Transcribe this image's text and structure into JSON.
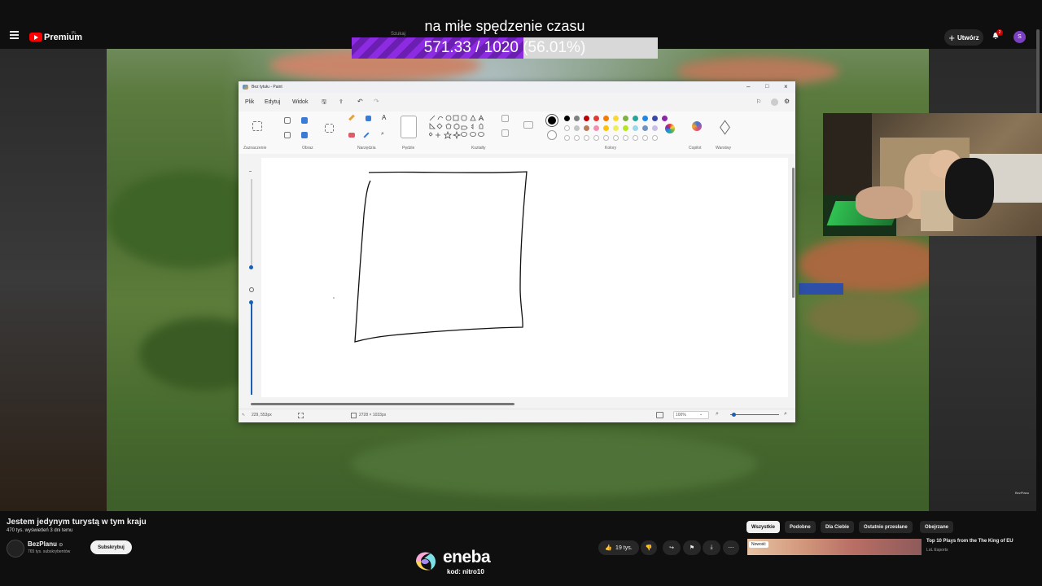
{
  "youtube": {
    "premium_label": "Premium",
    "country_code": "PL",
    "search_placeholder": "Szukaj",
    "create_label": "Utwórz",
    "notification_count": "2",
    "avatar_letter": "S"
  },
  "overlay": {
    "title": "na miłe spędzenie czasu",
    "progress_text": "571.33 / 1020",
    "progress_pct_text": "(56.01%)",
    "progress_fraction": 0.5601
  },
  "paint": {
    "window_title": "Bez tytułu - Paint",
    "menu": [
      "Plik",
      "Edytuj",
      "Widok"
    ],
    "groups": {
      "selection": "Zaznaczenie",
      "image": "Obraz",
      "tools": "Narzędzia",
      "brushes": "Pędzle",
      "shapes": "Kształty",
      "colors": "Kolory",
      "copilot": "Copilot",
      "layers": "Warstwy"
    },
    "palette": [
      "#000000",
      "#7f7f7f",
      "#c00000",
      "#e53935",
      "#f57c00",
      "#fdd835",
      "#7cb342",
      "#26a69a",
      "#1e88e5",
      "#3949ab",
      "#8e24aa"
    ],
    "palette_row2": [
      "#ffffff",
      "#c3c3c3",
      "#b97a57",
      "#f48fb1",
      "#ffc107",
      "#eeee58",
      "#b5e61d",
      "#99d9ea",
      "#7092be",
      "#c8bfe7"
    ],
    "status": {
      "cursor_pos": "229, 553px",
      "canvas_size": "2728 × 1033px",
      "zoom": "100%"
    }
  },
  "video": {
    "watermark": "BezPlanu",
    "title": "Jestem jedynym turystą w tym kraju",
    "meta": "470 tys. wyświetleń  3 dni temu",
    "channel_name": "BezPlanu",
    "channel_subs": "765 tys. subskrybentów",
    "subscribe_label": "Subskrybuj",
    "like_count": "19 tys."
  },
  "chips": [
    "Wszystkie",
    "Podobne",
    "Dla Ciebie",
    "Ostatnio przesłane",
    "Obejrzane"
  ],
  "recommendation": {
    "badge": "Nowość",
    "title": "Top 10 Plays from the The King of EU",
    "channel": "LoL Esports"
  },
  "sponsor": {
    "name": "eneba",
    "code": "kod: nitro10"
  }
}
